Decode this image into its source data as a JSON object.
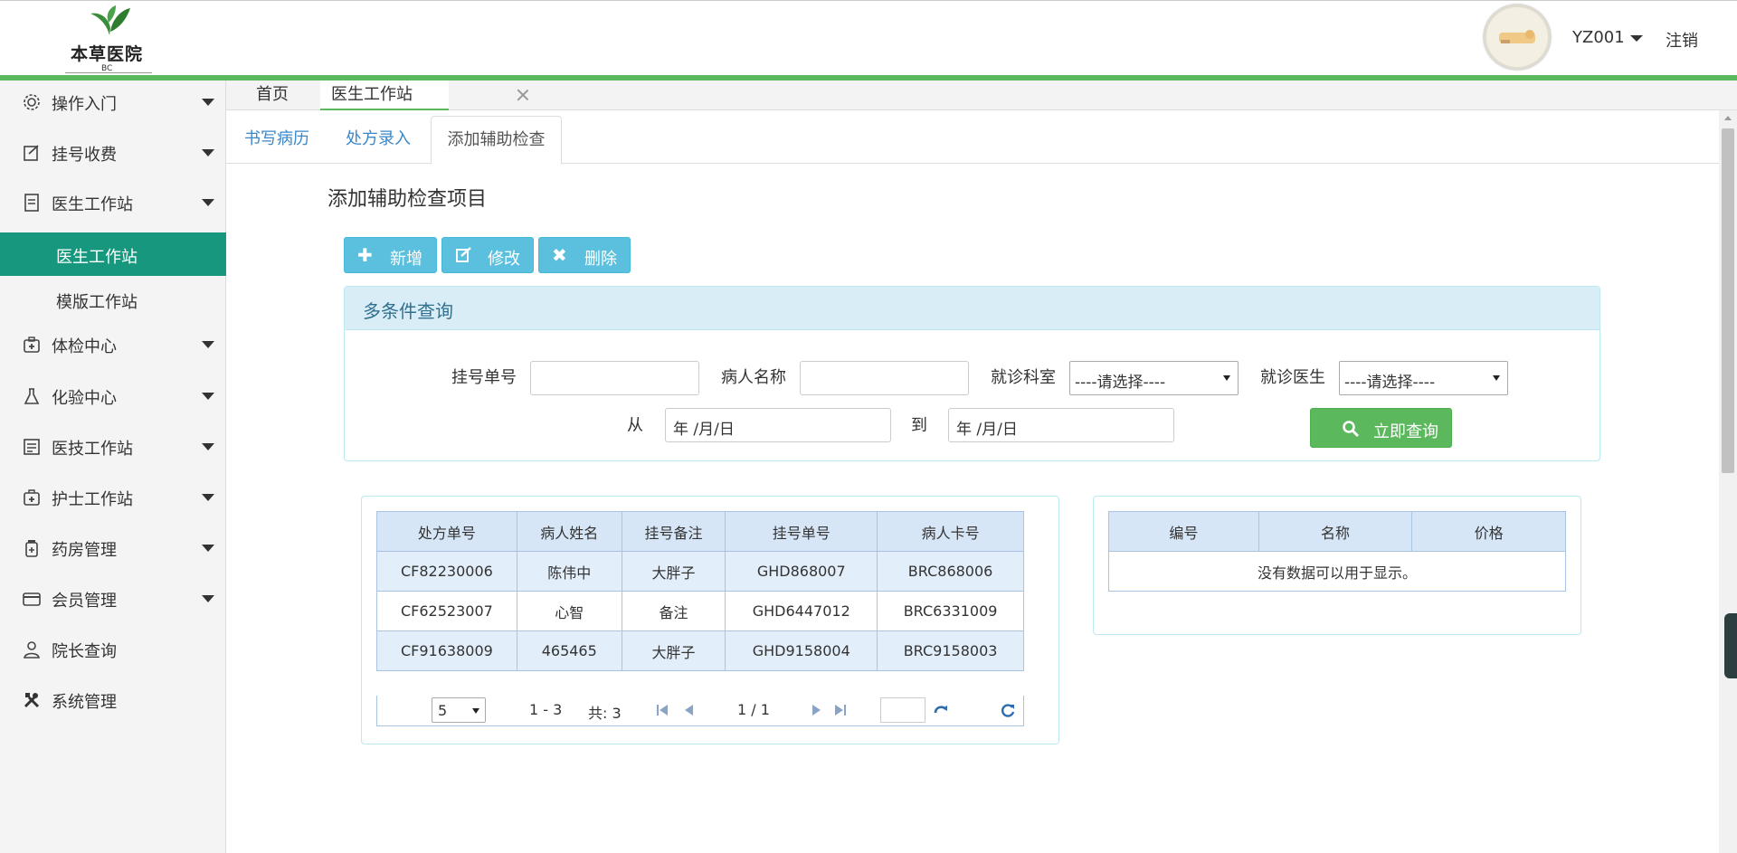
{
  "header": {
    "logo_title": "本草医院",
    "logo_sub": "BC",
    "user": "YZ001",
    "logout": "注销"
  },
  "sidebar": {
    "items": [
      {
        "label": "操作入门",
        "icon": "gear-icon"
      },
      {
        "label": "挂号收费",
        "icon": "edit-icon"
      },
      {
        "label": "医生工作站",
        "icon": "doc-icon"
      },
      {
        "label": "体检中心",
        "icon": "medkit-icon"
      },
      {
        "label": "化验中心",
        "icon": "flask-icon"
      },
      {
        "label": "医技工作站",
        "icon": "list-icon"
      },
      {
        "label": "护士工作站",
        "icon": "nurse-icon"
      },
      {
        "label": "药房管理",
        "icon": "pharmacy-icon"
      },
      {
        "label": "会员管理",
        "icon": "card-icon"
      },
      {
        "label": "院长查询",
        "icon": "user-icon"
      },
      {
        "label": "系统管理",
        "icon": "tools-icon"
      }
    ],
    "sub_items": [
      {
        "label": "医生工作站",
        "active": true
      },
      {
        "label": "模版工作站",
        "active": false
      }
    ]
  },
  "top_tabs": {
    "home": "首页",
    "doctor_station": "医生工作站"
  },
  "sub_tabs": [
    "书写病历",
    "处方录入",
    "添加辅助检查"
  ],
  "page_title": "添加辅助检查项目",
  "toolbar": {
    "add": "新增",
    "edit": "修改",
    "delete": "删除"
  },
  "query": {
    "title": "多条件查询",
    "reg_no_label": "挂号单号",
    "patient_name_label": "病人名称",
    "dept_label": "就诊科室",
    "dept_value": "----请选择----",
    "doctor_label": "就诊医生",
    "doctor_value": "----请选择----",
    "from_label": "从",
    "from_value": "年 /月/日",
    "to_label": "到",
    "to_value": "年 /月/日",
    "search_button": "立即查询"
  },
  "prescription_table": {
    "columns": [
      "处方单号",
      "病人姓名",
      "挂号备注",
      "挂号单号",
      "病人卡号"
    ],
    "rows": [
      [
        "CF82230006",
        "陈伟中",
        "大胖子",
        "GHD868007",
        "BRC868006"
      ],
      [
        "CF62523007",
        "心智",
        "备注",
        "GHD6447012",
        "BRC6331009"
      ],
      [
        "CF91638009",
        "465465",
        "大胖子",
        "GHD9158004",
        "BRC9158003"
      ]
    ]
  },
  "pager": {
    "page_size": "5",
    "range": "1 - 3",
    "total": "共: 3",
    "page": "1 / 1"
  },
  "check_table": {
    "columns": [
      "编号",
      "名称",
      "价格"
    ],
    "empty_text": "没有数据可以用于显示。"
  },
  "colors": {
    "primary_green": "#5cb85c",
    "active_teal": "#17987e",
    "info_blue": "#5bc0de",
    "panel_head": "#d9edf7"
  }
}
